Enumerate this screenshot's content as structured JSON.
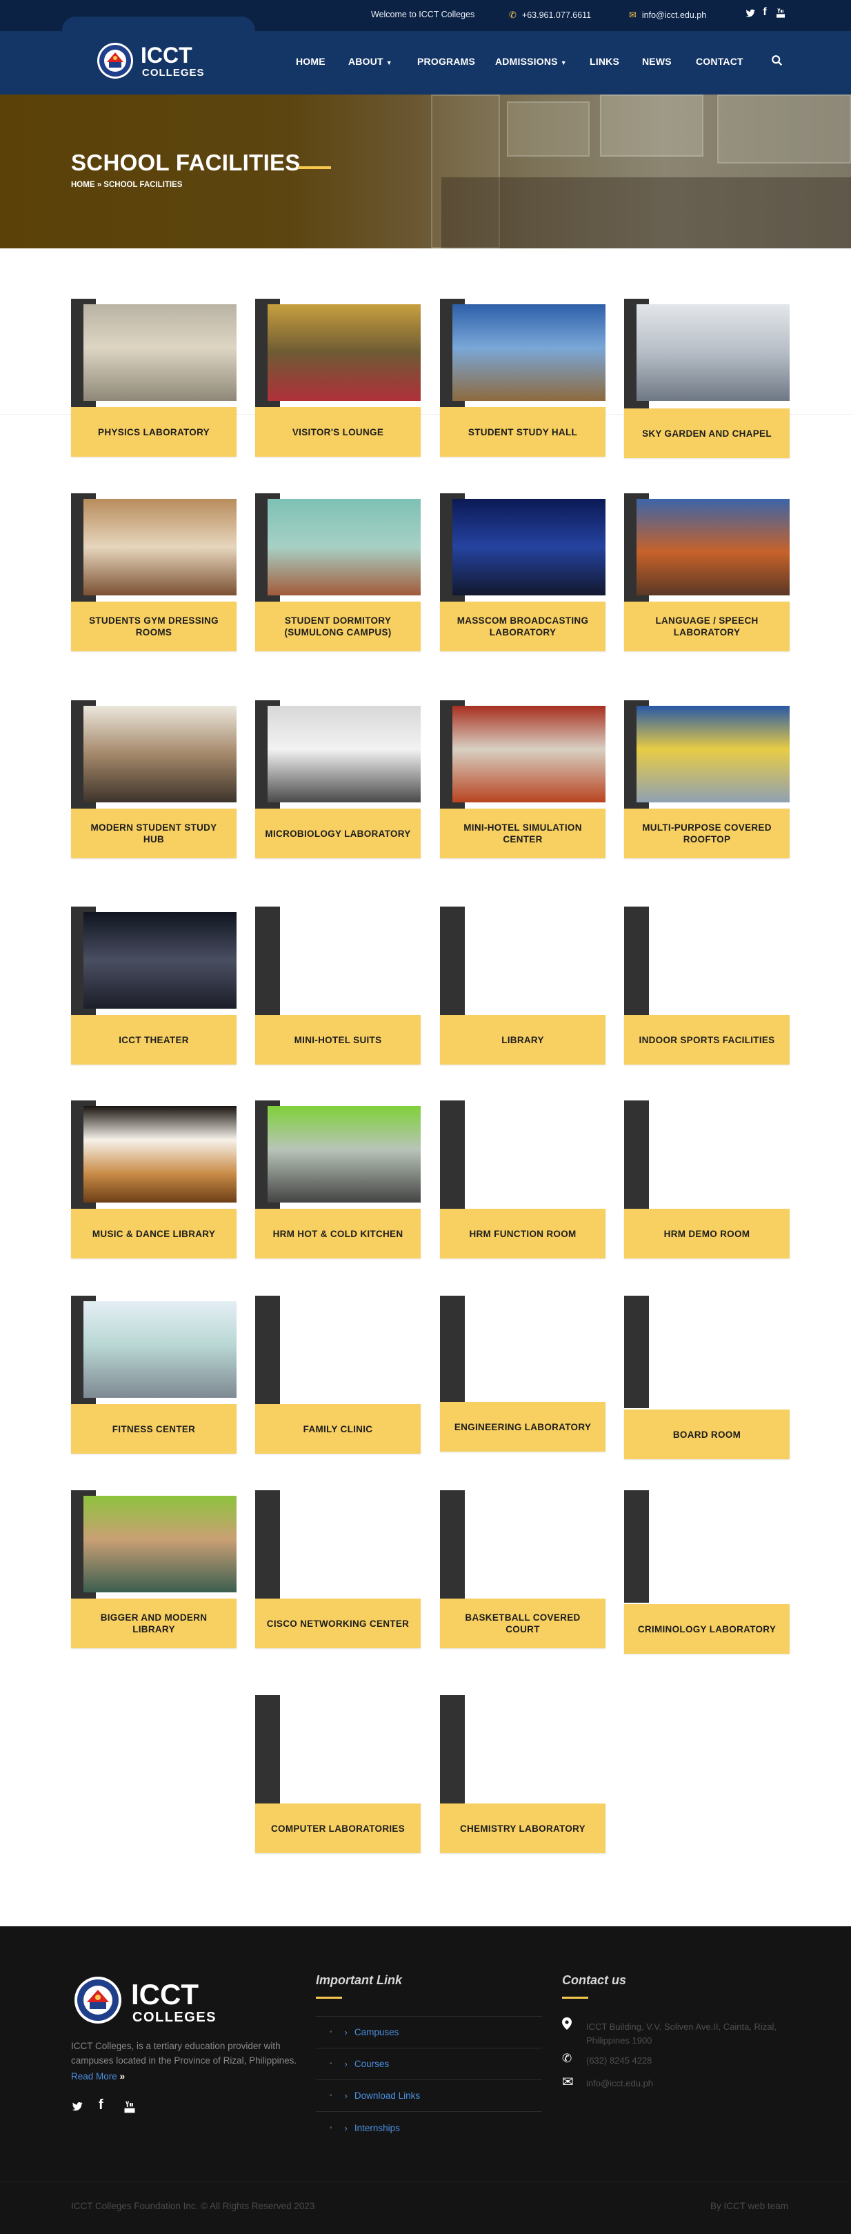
{
  "topbar": {
    "welcome": "Welcome to ICCT Colleges",
    "phone": "+63.961.077.6611",
    "email": "info@icct.edu.ph",
    "social": [
      "twitter-icon",
      "facebook-icon",
      "youtube-icon"
    ]
  },
  "brand": {
    "name": "ICCT",
    "sub": "COLLEGES"
  },
  "nav": {
    "items": [
      "HOME",
      "ABOUT",
      "PROGRAMS",
      "ADMISSIONS",
      "LINKS",
      "NEWS",
      "CONTACT"
    ]
  },
  "hero": {
    "title": "SCHOOL FACILITIES",
    "breadcrumb": "HOME » SCHOOL FACILITIES"
  },
  "facilities": [
    "PHYSICS LABORATORY",
    "VISITOR'S LOUNGE",
    "STUDENT STUDY HALL",
    "SKY GARDEN AND CHAPEL",
    "STUDENTS GYM DRESSING ROOMS",
    "STUDENT DORMITORY (SUMULONG CAMPUS)",
    "MASSCOM BROADCASTING LABORATORY",
    "LANGUAGE / SPEECH LABORATORY",
    "MODERN STUDENT STUDY HUB",
    "MICROBIOLOGY LABORATORY",
    "MINI-HOTEL SIMULATION CENTER",
    "MULTI-PURPOSE COVERED ROOFTOP",
    "ICCT THEATER",
    "MINI-HOTEL SUITS",
    "LIBRARY",
    "INDOOR SPORTS FACILITIES",
    "MUSIC & DANCE LIBRARY",
    "HRM HOT & COLD KITCHEN",
    "HRM FUNCTION ROOM",
    "HRM DEMO ROOM",
    "FITNESS CENTER",
    "FAMILY CLINIC",
    "ENGINEERING LABORATORY",
    "BOARD ROOM",
    "BIGGER AND MODERN LIBRARY",
    "CISCO NETWORKING CENTER",
    "BASKETBALL COVERED COURT",
    "CRIMINOLOGY LABORATORY",
    "COMPUTER LABORATORIES",
    "CHEMISTRY LABORATORY"
  ],
  "footer": {
    "desc": "ICCT Colleges, is a tertiary education provider with campuses located in the Province of Rizal, Philippines.",
    "read_more": "Read More",
    "links_title": "Important Link",
    "links": [
      "Campuses",
      "Courses",
      "Download Links",
      "Internships"
    ],
    "contact_title": "Contact us",
    "address": "ICCT Building, V.V. Soliven Ave.II, Cainta, Rizal, Philippines 1900",
    "phone": "(632) 8245 4228",
    "email": "info@icct.edu.ph",
    "copyright": "ICCT Colleges Foundation Inc. © All Rights Reserved 2023",
    "credit": "By ICCT web team"
  }
}
